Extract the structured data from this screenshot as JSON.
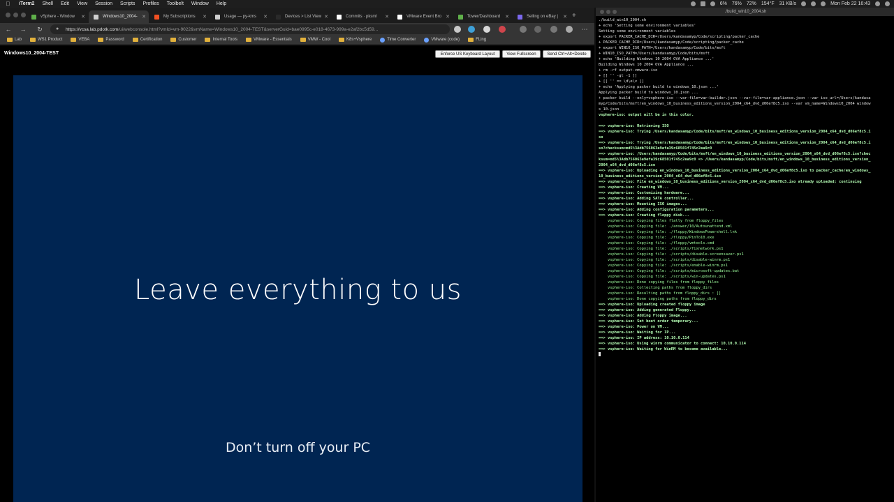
{
  "menubar": {
    "app": "iTerm2",
    "items": [
      "Shell",
      "Edit",
      "View",
      "Session",
      "Scripts",
      "Profiles",
      "Toolbelt",
      "Window",
      "Help"
    ],
    "status": {
      "battery": "72%",
      "cpu": "6%",
      "mem": "76%",
      "temp": "154°F",
      "net": "31 KB/s",
      "datetime": "Mon Feb 22 16:43"
    }
  },
  "browser": {
    "tabs": [
      {
        "label": "vSphere - Window",
        "color": "#5fb04a"
      },
      {
        "label": "Windows10_2004-",
        "color": "#cfcfcf",
        "active": true
      },
      {
        "label": "My Subscriptions",
        "color": "#f25022"
      },
      {
        "label": "Usage — py-kms",
        "color": "#cfcfcf"
      },
      {
        "label": "Devices > List View",
        "color": "#2a2a2a"
      },
      {
        "label": "Commits · pksm/",
        "color": "#ffffff"
      },
      {
        "label": "VMware Event Bro",
        "color": "#ffffff"
      },
      {
        "label": "Tower/Dashboard",
        "color": "#5fb04a"
      },
      {
        "label": "Selling on eBay |",
        "color": "#7b68ee"
      }
    ],
    "url": "https://vcsa.lab.pdotk.com",
    "url_path": "/ui/webconsole.html?vmId=vm-9022&vmName=Windows10_2004-TEST&serverGuid=bae0995c-e018-4673-999a-e2af2bc5d59...",
    "bookmarks": [
      {
        "label": "Lab",
        "kind": "folder"
      },
      {
        "label": "WS1 Product",
        "kind": "folder"
      },
      {
        "label": "VEBA",
        "kind": "folder"
      },
      {
        "label": "Password",
        "kind": "folder"
      },
      {
        "label": "Certification",
        "kind": "folder"
      },
      {
        "label": "Customer",
        "kind": "folder"
      },
      {
        "label": "Internal Tools",
        "kind": "folder"
      },
      {
        "label": "VMware - Essentials",
        "kind": "folder"
      },
      {
        "label": "VMW - Cool",
        "kind": "folder"
      },
      {
        "label": "K8s+Vsphere",
        "kind": "folder"
      },
      {
        "label": "Time Converter",
        "kind": "link"
      },
      {
        "label": "VMware (code)",
        "kind": "link"
      },
      {
        "label": "FLing",
        "kind": "folder"
      }
    ]
  },
  "console": {
    "vm_name": "Windows10_2004-TEST",
    "buttons": {
      "keyboard": "Enforce US Keyboard Layout",
      "fullscreen": "View Fullscreen",
      "cad": "Send Ctrl+Alt+Delete"
    },
    "screen": {
      "message": "Leave everything to us",
      "sub_message": "Don’t turn off your PC",
      "bg_color": "#002552"
    }
  },
  "terminal": {
    "title": "./build_win10_2004.sh",
    "lines": [
      {
        "t": "./build_win10_2004.sh",
        "c": "white"
      },
      {
        "t": "+ echo 'Setting some environment variables'",
        "c": "white"
      },
      {
        "t": "Setting some environment variables",
        "c": "white"
      },
      {
        "t": "+ export PACKER_CACHE_DIR=/Users/kandasamyp/Code/scripting/packer_cache",
        "c": "white"
      },
      {
        "t": "+ PACKER_CACHE_DIR=/Users/kandasamyp/Code/scripting/packer_cache",
        "c": "white"
      },
      {
        "t": "+ export WIN10_ISO_PATH=/Users/kandasamyp/Code/bits/msft",
        "c": "white"
      },
      {
        "t": "+ WIN10_ISO_PATH=/Users/kandasamyp/Code/bits/msft",
        "c": "white"
      },
      {
        "t": "+ echo 'Building Windows 10 2004 OVA Appliance ...'",
        "c": "white"
      },
      {
        "t": "Building Windows 10 2004 OVA Appliance ...",
        "c": "white"
      },
      {
        "t": "+ rm -rf output-vmware-iso",
        "c": "white"
      },
      {
        "t": "+ [[ '' -gt -1 ]]",
        "c": "white"
      },
      {
        "t": "+ [[ '' == \\d\\e\\v ]]",
        "c": "white"
      },
      {
        "t": "+ echo 'Applying packer build to windows_10.json ...'",
        "c": "white"
      },
      {
        "t": "Applying packer build to windows_10.json ...",
        "c": "white"
      },
      {
        "t": "+ packer build --only=vsphere-iso --var-file=var-builder.json --var-file=var-appliance.json --var iso_url=/Users/kandasa",
        "c": "white"
      },
      {
        "t": "myp/Code/bits/msft/en_windows_10_business_editions_version_2004_x64_dvd_d06ef8c5.iso --var vm_name=Windows10_2004 window",
        "c": "white"
      },
      {
        "t": "s_10.json",
        "c": "white"
      },
      {
        "t": "vsphere-iso: output will be in this color.",
        "c": "bgreen"
      },
      {
        "t": "",
        "c": "white"
      },
      {
        "t": "==> vsphere-iso: Retrieving ISO",
        "c": "bgreen"
      },
      {
        "t": "==> vsphere-iso: Trying /Users/kandasamyp/Code/bits/msft/en_windows_10_business_editions_version_2004_x64_dvd_d06ef8c5.i",
        "c": "bgreen"
      },
      {
        "t": "so",
        "c": "bgreen"
      },
      {
        "t": "==> vsphere-iso: Trying /Users/kandasamyp/Code/bits/msft/en_windows_10_business_editions_version_2004_x64_dvd_d06ef8c5.i",
        "c": "bgreen"
      },
      {
        "t": "so?checksum=md5%3Adb756063e9efa39c68501f745c2ea9c0",
        "c": "bgreen"
      },
      {
        "t": "==> vsphere-iso: /Users/kandasamyp/Code/bits/msft/en_windows_10_business_editions_version_2004_x64_dvd_d06ef8c5.iso?chec",
        "c": "bgreen"
      },
      {
        "t": "ksum=md5%3Adb756063e9efa39c68501f745c2ea9c0 => /Users/kandasamyp/Code/bits/msft/en_windows_10_business_editions_version_",
        "c": "bgreen"
      },
      {
        "t": "2004_x64_dvd_d06ef8c5.iso",
        "c": "bgreen"
      },
      {
        "t": "==> vsphere-iso: Uploading en_windows_10_business_editions_version_2004_x64_dvd_d06ef8c5.iso to packer_cache/en_windows_",
        "c": "bgreen"
      },
      {
        "t": "10_business_editions_version_2004_x64_dvd_d06ef8c5.iso",
        "c": "bgreen"
      },
      {
        "t": "==> vsphere-iso: File en_windows_10_business_editions_version_2004_x64_dvd_d06ef8c5.iso already uploaded; continuing",
        "c": "bgreen"
      },
      {
        "t": "==> vsphere-iso: Creating VM...",
        "c": "bgreen"
      },
      {
        "t": "==> vsphere-iso: Customizing hardware...",
        "c": "bgreen"
      },
      {
        "t": "==> vsphere-iso: Adding SATA controller...",
        "c": "bgreen"
      },
      {
        "t": "==> vsphere-iso: Mounting ISO images...",
        "c": "bgreen"
      },
      {
        "t": "==> vsphere-iso: Adding configuration parameters...",
        "c": "bgreen"
      },
      {
        "t": "==> vsphere-iso: Creating floppy disk...",
        "c": "bgreen"
      },
      {
        "t": "    vsphere-iso: Copying files flatly from floppy_files",
        "c": "green"
      },
      {
        "t": "    vsphere-iso: Copying file: ./answer/10/Autounattend.xml",
        "c": "green"
      },
      {
        "t": "    vsphere-iso: Copying file: ./floppy/WindowsPowershell.lnk",
        "c": "green"
      },
      {
        "t": "    vsphere-iso: Copying file: ./floppy/PinTo10.exe",
        "c": "green"
      },
      {
        "t": "    vsphere-iso: Copying file: ./floppy/vmtools.cmd",
        "c": "green"
      },
      {
        "t": "    vsphere-iso: Copying file: ./scripts/fixnetwork.ps1",
        "c": "green"
      },
      {
        "t": "    vsphere-iso: Copying file: ./scripts/disable-screensaver.ps1",
        "c": "green"
      },
      {
        "t": "    vsphere-iso: Copying file: ./scripts/disable-winrm.ps1",
        "c": "green"
      },
      {
        "t": "    vsphere-iso: Copying file: ./scripts/enable-winrm.ps1",
        "c": "green"
      },
      {
        "t": "    vsphere-iso: Copying file: ./scripts/microsoft-updates.bat",
        "c": "green"
      },
      {
        "t": "    vsphere-iso: Copying file: ./scripts/win-updates.ps1",
        "c": "green"
      },
      {
        "t": "    vsphere-iso: Done copying files from floppy_files",
        "c": "green"
      },
      {
        "t": "    vsphere-iso: Collecting paths from floppy_dirs",
        "c": "green"
      },
      {
        "t": "    vsphere-iso: Resulting paths from floppy_dirs : []",
        "c": "green"
      },
      {
        "t": "    vsphere-iso: Done copying paths from floppy_dirs",
        "c": "green"
      },
      {
        "t": "==> vsphere-iso: Uploading created floppy image",
        "c": "bgreen"
      },
      {
        "t": "==> vsphere-iso: Adding generated Floppy...",
        "c": "bgreen"
      },
      {
        "t": "==> vsphere-iso: Adding Floppy image...",
        "c": "bgreen"
      },
      {
        "t": "==> vsphere-iso: Set boot order temporary...",
        "c": "bgreen"
      },
      {
        "t": "==> vsphere-iso: Power on VM...",
        "c": "bgreen"
      },
      {
        "t": "==> vsphere-iso: Waiting for IP...",
        "c": "bgreen"
      },
      {
        "t": "==> vsphere-iso: IP address: 10.10.0.114",
        "c": "bgreen"
      },
      {
        "t": "==> vsphere-iso: Using winrm communicator to connect: 10.10.0.114",
        "c": "bgreen"
      },
      {
        "t": "==> vsphere-iso: Waiting for WinRM to become available...",
        "c": "bgreen"
      }
    ]
  }
}
